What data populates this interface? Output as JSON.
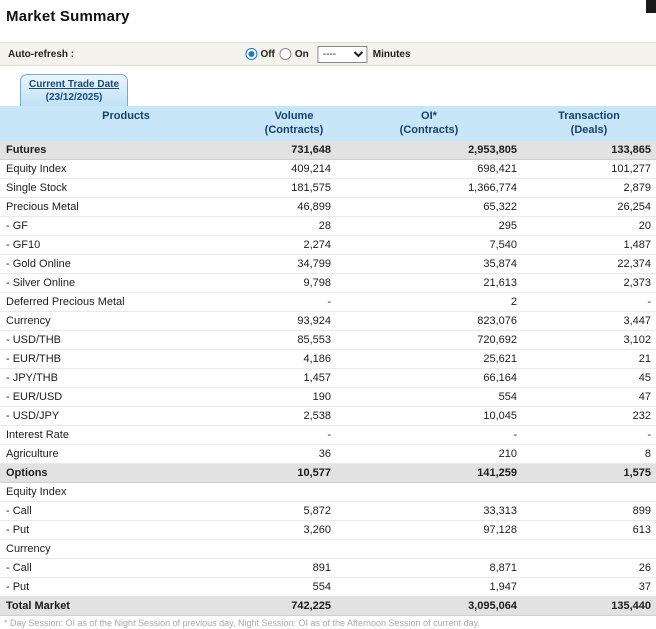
{
  "page": {
    "title": "Market Summary",
    "footnote": "* Day Session: OI as of the Night Session of previous day, Night Session: OI as of the Afternoon Session of current day."
  },
  "auto_refresh": {
    "label": "Auto-refresh :",
    "off_label": "Off",
    "on_label": "On",
    "selected": "Off",
    "dropdown_value": "----",
    "minutes_label": "Minutes"
  },
  "tab": {
    "line1": "Current Trade Date",
    "line2": "(23/12/2025)"
  },
  "colors": {
    "header_bg": "#c7e7f9",
    "section_bg": "#e2e2e2",
    "tab_border": "#74aacd",
    "radio_selected": "#1f76d2"
  },
  "table": {
    "columns": [
      {
        "line1": "Products",
        "line2": ""
      },
      {
        "line1": "Volume",
        "line2": "(Contracts)"
      },
      {
        "line1": "OI*",
        "line2": "(Contracts)"
      },
      {
        "line1": "Transaction",
        "line2": "(Deals)"
      }
    ],
    "rows": [
      {
        "product": "Futures",
        "volume": "731,648",
        "oi": "2,953,805",
        "deals": "133,865",
        "style": "section"
      },
      {
        "product": "Equity Index",
        "volume": "409,214",
        "oi": "698,421",
        "deals": "101,277",
        "style": "normal"
      },
      {
        "product": "Single Stock",
        "volume": "181,575",
        "oi": "1,366,774",
        "deals": "2,879",
        "style": "normal"
      },
      {
        "product": "Precious Metal",
        "volume": "46,899",
        "oi": "65,322",
        "deals": "26,254",
        "style": "normal"
      },
      {
        "product": "- GF",
        "volume": "28",
        "oi": "295",
        "deals": "20",
        "style": "normal"
      },
      {
        "product": "- GF10",
        "volume": "2,274",
        "oi": "7,540",
        "deals": "1,487",
        "style": "normal"
      },
      {
        "product": "- Gold Online",
        "volume": "34,799",
        "oi": "35,874",
        "deals": "22,374",
        "style": "normal"
      },
      {
        "product": "- Silver Online",
        "volume": "9,798",
        "oi": "21,613",
        "deals": "2,373",
        "style": "normal"
      },
      {
        "product": "Deferred Precious Metal",
        "volume": "-",
        "oi": "2",
        "deals": "-",
        "style": "normal"
      },
      {
        "product": "Currency",
        "volume": "93,924",
        "oi": "823,076",
        "deals": "3,447",
        "style": "normal"
      },
      {
        "product": "- USD/THB",
        "volume": "85,553",
        "oi": "720,692",
        "deals": "3,102",
        "style": "normal"
      },
      {
        "product": "- EUR/THB",
        "volume": "4,186",
        "oi": "25,621",
        "deals": "21",
        "style": "normal"
      },
      {
        "product": "- JPY/THB",
        "volume": "1,457",
        "oi": "66,164",
        "deals": "45",
        "style": "normal"
      },
      {
        "product": "- EUR/USD",
        "volume": "190",
        "oi": "554",
        "deals": "47",
        "style": "normal"
      },
      {
        "product": "- USD/JPY",
        "volume": "2,538",
        "oi": "10,045",
        "deals": "232",
        "style": "normal"
      },
      {
        "product": "Interest Rate",
        "volume": "-",
        "oi": "-",
        "deals": "-",
        "style": "normal"
      },
      {
        "product": "Agriculture",
        "volume": "36",
        "oi": "210",
        "deals": "8",
        "style": "normal"
      },
      {
        "product": "Options",
        "volume": "10,577",
        "oi": "141,259",
        "deals": "1,575",
        "style": "section"
      },
      {
        "product": "Equity Index",
        "volume": "",
        "oi": "",
        "deals": "",
        "style": "group"
      },
      {
        "product": "- Call",
        "volume": "5,872",
        "oi": "33,313",
        "deals": "899",
        "style": "normal"
      },
      {
        "product": "- Put",
        "volume": "3,260",
        "oi": "97,128",
        "deals": "613",
        "style": "normal"
      },
      {
        "product": "Currency",
        "volume": "",
        "oi": "",
        "deals": "",
        "style": "group"
      },
      {
        "product": "- Call",
        "volume": "891",
        "oi": "8,871",
        "deals": "26",
        "style": "normal"
      },
      {
        "product": "- Put",
        "volume": "554",
        "oi": "1,947",
        "deals": "37",
        "style": "normal"
      },
      {
        "product": "Total Market",
        "volume": "742,225",
        "oi": "3,095,064",
        "deals": "135,440",
        "style": "total"
      }
    ]
  }
}
